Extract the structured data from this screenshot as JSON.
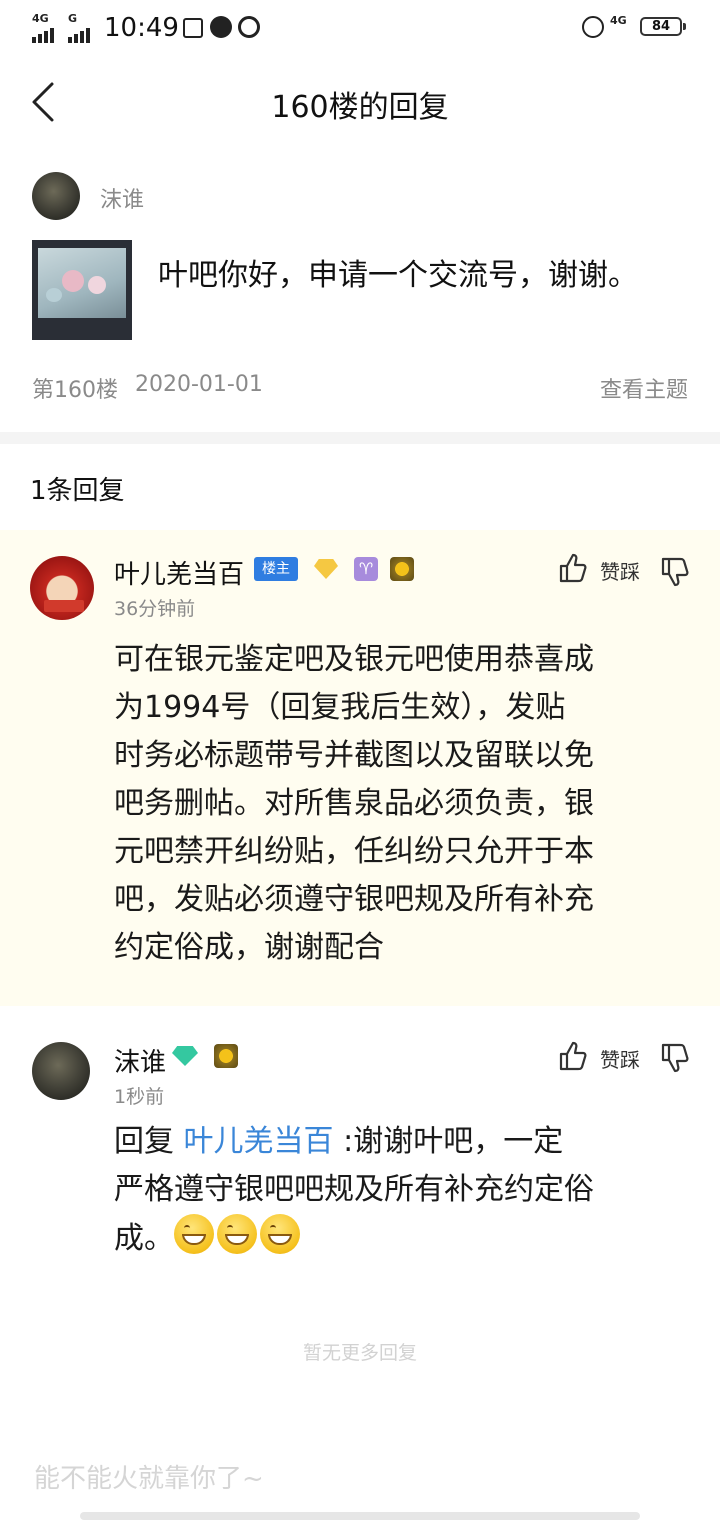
{
  "status_bar": {
    "net1": "4G",
    "net2": "G",
    "time": "10:49",
    "net3": "4G",
    "battery": "84"
  },
  "header": {
    "title": "160楼的回复"
  },
  "post": {
    "author": "沫谁",
    "text": "叶吧你好，申请一个交流号，谢谢。",
    "floor": "第160楼",
    "date": "2020-01-01",
    "view_topic": "查看主题"
  },
  "replies_count": "1条回复",
  "replies": [
    {
      "author": "叶儿羌当百",
      "badge": "楼主",
      "time": "36分钟前",
      "action": "赞踩",
      "text": "可在银元鉴定吧及银元吧使用恭喜成为1994号（回复我后生效），发贴时务必标题带号并截图以及留联以免吧务删帖。对所售泉品必须负责，银元吧禁开纠纷贴，任纠纷只允开于本吧，发贴必须遵守银吧规及所有补充约定俗成，谢谢配合",
      "lines": [
        "可在银元鉴定吧及银元吧使用恭喜成",
        "为1994号（回复我后生效），发贴",
        "时务必标题带号并截图以及留联以免",
        "吧务删帖。对所售泉品必须负责，银",
        "元吧禁开纠纷贴，任纠纷只允开于本",
        "吧，发贴必须遵守银吧规及所有补充",
        "约定俗成，谢谢配合"
      ]
    },
    {
      "author": "沫谁",
      "time": "1秒前",
      "action": "赞踩",
      "reply_prefix": "回复",
      "reply_to": "叶儿羌当百",
      "line1_rest": ":谢谢叶吧，一定",
      "line2": "严格遵守银吧吧规及所有补充约定俗",
      "line3": "成。"
    }
  ],
  "no_more": "暂无更多回复",
  "input_placeholder": "能不能火就靠你了~",
  "colors": {
    "badge_blue": "#2f7de1",
    "link_blue": "#3a86d8",
    "highlight_bg": "#fffdf0"
  }
}
